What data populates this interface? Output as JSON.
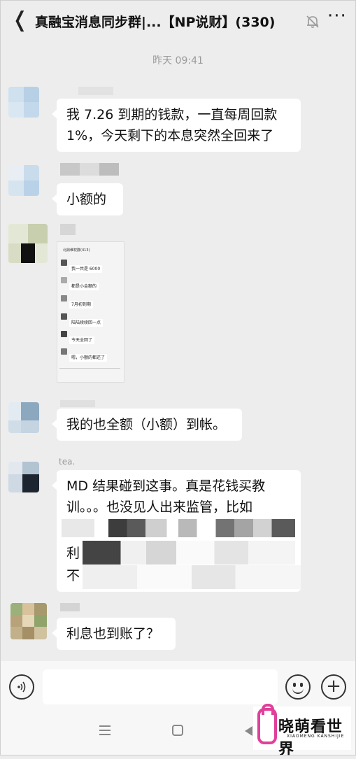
{
  "header": {
    "back_glyph": "❬",
    "title": "真融宝消息同步群|...【NP说财】(330)",
    "more_glyph": "···"
  },
  "timestamp": "昨天 09:41",
  "messages": [
    {
      "text": "我 7.26 到期的钱款，一直每周回款 1%，今天剩下的本息突然全回来了"
    },
    {
      "text": "小额的"
    },
    {
      "image": {
        "title": "北鼎维权群(413)",
        "lines": [
          "我一共是 6000",
          "都是小金额的",
          "7月初到期",
          "陆陆续续回一点",
          "今天全回了",
          "嗯，小额的都还了"
        ]
      }
    },
    {
      "text": "我的也全额（小额）到帐。"
    },
    {
      "sender": "tea.",
      "text": "MD 结果碰到这事。真是花钱买教训。。。也没见人出来监管，比如",
      "partial_chars": [
        "利",
        "不"
      ]
    },
    {
      "text": "利息也到账了？"
    }
  ],
  "input_bar": {
    "voice_icon": "voice-icon",
    "emoji_icon": "emoji-icon",
    "plus_glyph": "+"
  },
  "watermark": {
    "text": "晓萌看世界",
    "subtext": "XIAOMENG KANSHIJIE",
    "accent": "#e0409a"
  }
}
